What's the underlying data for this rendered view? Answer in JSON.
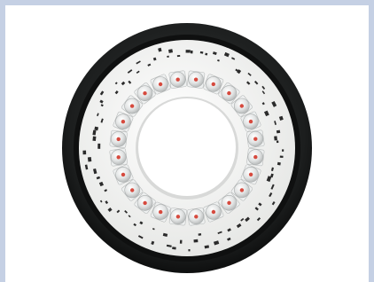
{
  "image": {
    "subject": "ring-led-pcb",
    "colors": {
      "frame": "#c5d0e4",
      "background": "#ffffff",
      "outer_ring": "#1a1c1c",
      "pcb": "#f3f3f1",
      "led_body": "#eef0f0",
      "led_lens": "#d9d9d9",
      "led_die": "#d64a3e",
      "smd_component": "#2b2b2b"
    },
    "led_count": 24
  }
}
